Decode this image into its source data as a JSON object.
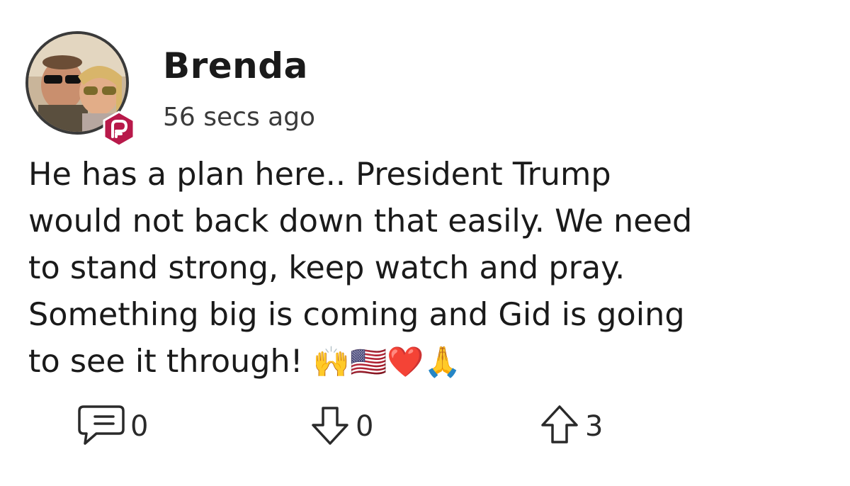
{
  "post": {
    "author": "Brenda",
    "timestamp": "56 secs ago",
    "body": "He has a plan here.. President Trump\nwould not back down that easily. We need\nto stand strong, keep watch and pray.\nSomething big is coming and Gid is going\nto see it through! ",
    "emojis": "🙌🇺🇸❤️🙏",
    "actions": {
      "comments": "0",
      "downvotes": "0",
      "upvotes": "3"
    }
  },
  "icons": {
    "badge": "parler-p-icon",
    "comment": "comment-bubble-icon",
    "downvote": "arrow-down-icon",
    "upvote": "arrow-up-icon"
  },
  "colors": {
    "badge": "#b8194a",
    "text": "#1a1a1a",
    "avatar_border": "#3a3a3a"
  }
}
